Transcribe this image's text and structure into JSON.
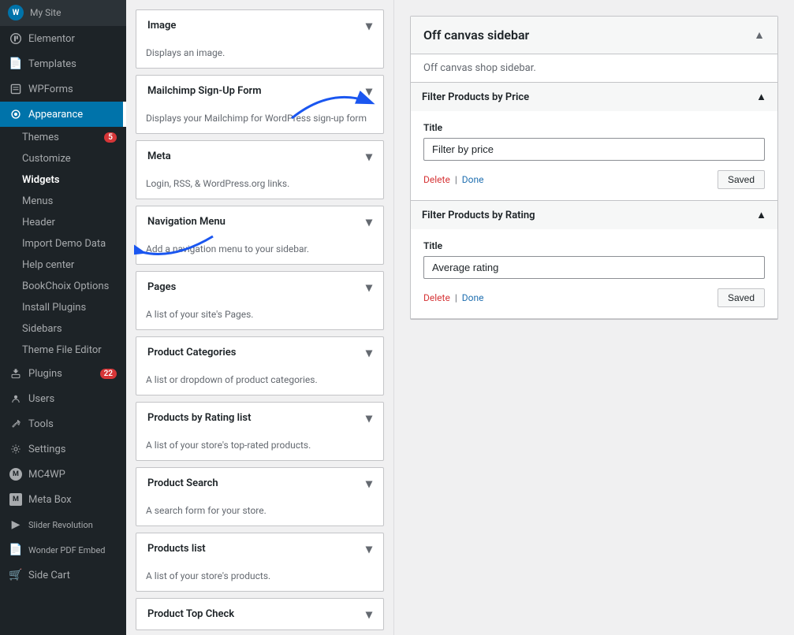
{
  "sidebar": {
    "items": [
      {
        "id": "elementor",
        "label": "Elementor",
        "icon": "⚡",
        "badge": null
      },
      {
        "id": "templates",
        "label": "Templates",
        "icon": "📄",
        "badge": null
      },
      {
        "id": "wpforms",
        "label": "WPForms",
        "icon": "📋",
        "badge": null
      },
      {
        "id": "appearance",
        "label": "Appearance",
        "icon": "🎨",
        "badge": null,
        "active": true
      },
      {
        "id": "plugins",
        "label": "Plugins",
        "icon": "🔌",
        "badge": "22"
      },
      {
        "id": "users",
        "label": "Users",
        "icon": "👤",
        "badge": null
      },
      {
        "id": "tools",
        "label": "Tools",
        "icon": "🔧",
        "badge": null
      },
      {
        "id": "settings",
        "label": "Settings",
        "icon": "⚙️",
        "badge": null
      },
      {
        "id": "mc4wp",
        "label": "MC4WP",
        "icon": "✉️",
        "badge": null
      },
      {
        "id": "metabox",
        "label": "Meta Box",
        "icon": "M",
        "badge": null
      },
      {
        "id": "slider",
        "label": "Slider Revolution",
        "icon": "▶️",
        "badge": null
      },
      {
        "id": "wonder",
        "label": "Wonder PDF Embed",
        "icon": "📄",
        "badge": null
      },
      {
        "id": "sidecart",
        "label": "Side Cart",
        "icon": "🛒",
        "badge": null
      }
    ],
    "sub_items": [
      {
        "id": "themes",
        "label": "Themes",
        "badge": "5"
      },
      {
        "id": "customize",
        "label": "Customize"
      },
      {
        "id": "widgets",
        "label": "Widgets",
        "active": true
      },
      {
        "id": "menus",
        "label": "Menus"
      },
      {
        "id": "header",
        "label": "Header"
      },
      {
        "id": "import",
        "label": "Import Demo Data"
      },
      {
        "id": "help",
        "label": "Help center"
      },
      {
        "id": "bookchoix",
        "label": "BookChoix Options"
      },
      {
        "id": "install",
        "label": "Install Plugins"
      },
      {
        "id": "sidebars",
        "label": "Sidebars"
      },
      {
        "id": "theme-editor",
        "label": "Theme File Editor"
      }
    ]
  },
  "widgets_list": [
    {
      "id": "image",
      "label": "Image",
      "desc": "Displays an image."
    },
    {
      "id": "mailchimp",
      "label": "Mailchimp Sign-Up Form",
      "desc": "Displays your Mailchimp for WordPress sign-up form"
    },
    {
      "id": "meta",
      "label": "Meta",
      "desc": "Login, RSS, & WordPress.org links."
    },
    {
      "id": "nav-menu",
      "label": "Navigation Menu",
      "desc": "Add a navigation menu to your sidebar."
    },
    {
      "id": "pages",
      "label": "Pages",
      "desc": "A list of your site's Pages."
    },
    {
      "id": "product-categories",
      "label": "Product Categories",
      "desc": "A list or dropdown of product categories."
    },
    {
      "id": "products-by-rating",
      "label": "Products by Rating list",
      "desc": "A list of your store's top-rated products."
    },
    {
      "id": "product-search",
      "label": "Product Search",
      "desc": "A search form for your store."
    },
    {
      "id": "products-list",
      "label": "Products list",
      "desc": "A list of your store's products."
    },
    {
      "id": "product-top-check",
      "label": "Product Top Check",
      "desc": ""
    }
  ],
  "right_panel": {
    "title": "Off canvas sidebar",
    "description": "Off canvas shop sidebar.",
    "widget1": {
      "title": "Filter Products by Price",
      "field_label": "Title",
      "field_value": "Filter by price",
      "delete_label": "Delete",
      "done_label": "Done",
      "saved_label": "Saved"
    },
    "widget2": {
      "title": "Filter Products by Rating",
      "field_label": "Title",
      "field_value": "Average rating",
      "delete_label": "Delete",
      "done_label": "Done",
      "saved_label": "Saved"
    }
  }
}
